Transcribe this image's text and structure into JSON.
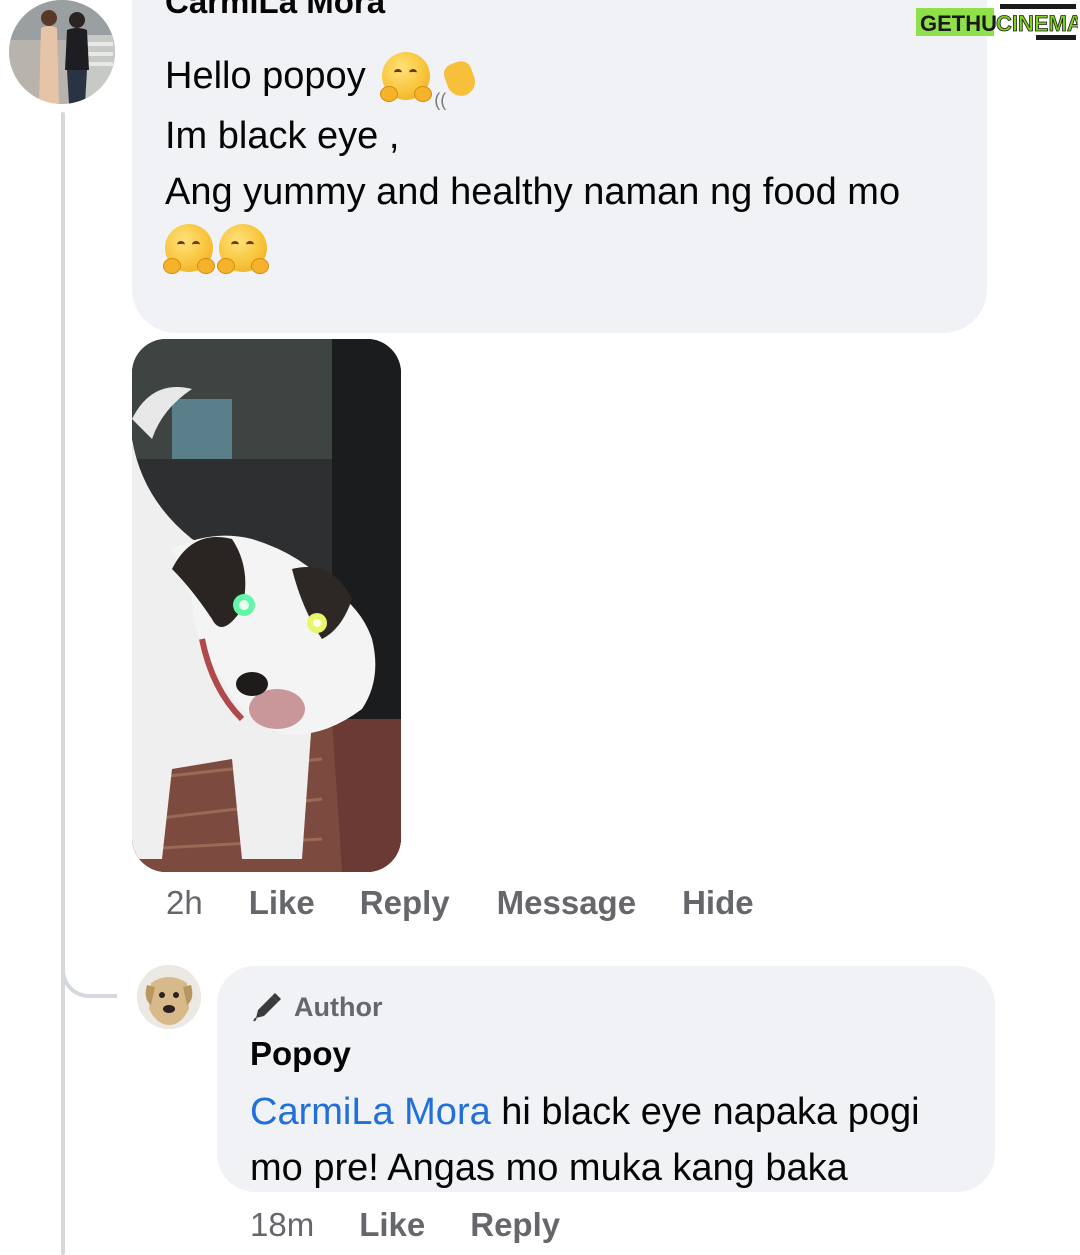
{
  "watermark": {
    "part1": "GETHU",
    "part2": "CINEMA",
    "color1": "#1a1a1a",
    "color2": "#7ed321",
    "bg": "#8fe04a"
  },
  "comment": {
    "author_name": "CarmiLa Mora",
    "lines": [
      "Hello popoy",
      "Im black eye ,",
      "Ang yummy and healthy naman ng food mo"
    ],
    "emojis": [
      "hugging-face-emoji",
      "waving-hand-emoji",
      "hugging-face-emoji",
      "hugging-face-emoji"
    ],
    "photo_icon": "dog-photo",
    "time": "2h",
    "actions": [
      "Like",
      "Reply",
      "Message",
      "Hide"
    ]
  },
  "reply": {
    "badge": "Author",
    "badge_icon": "pen-icon",
    "author_name": "Popoy",
    "mention": "CarmiLa Mora",
    "text_line1": "hi black eye napaka pogi",
    "text_line2": "mo pre! Angas mo muka kang baka",
    "time": "18m",
    "actions": [
      "Like",
      "Reply"
    ]
  },
  "colors": {
    "bubble": "#f0f2f5",
    "action_text": "#65676b",
    "mention": "#216fdb",
    "thread_line": "#d5d8dd"
  }
}
